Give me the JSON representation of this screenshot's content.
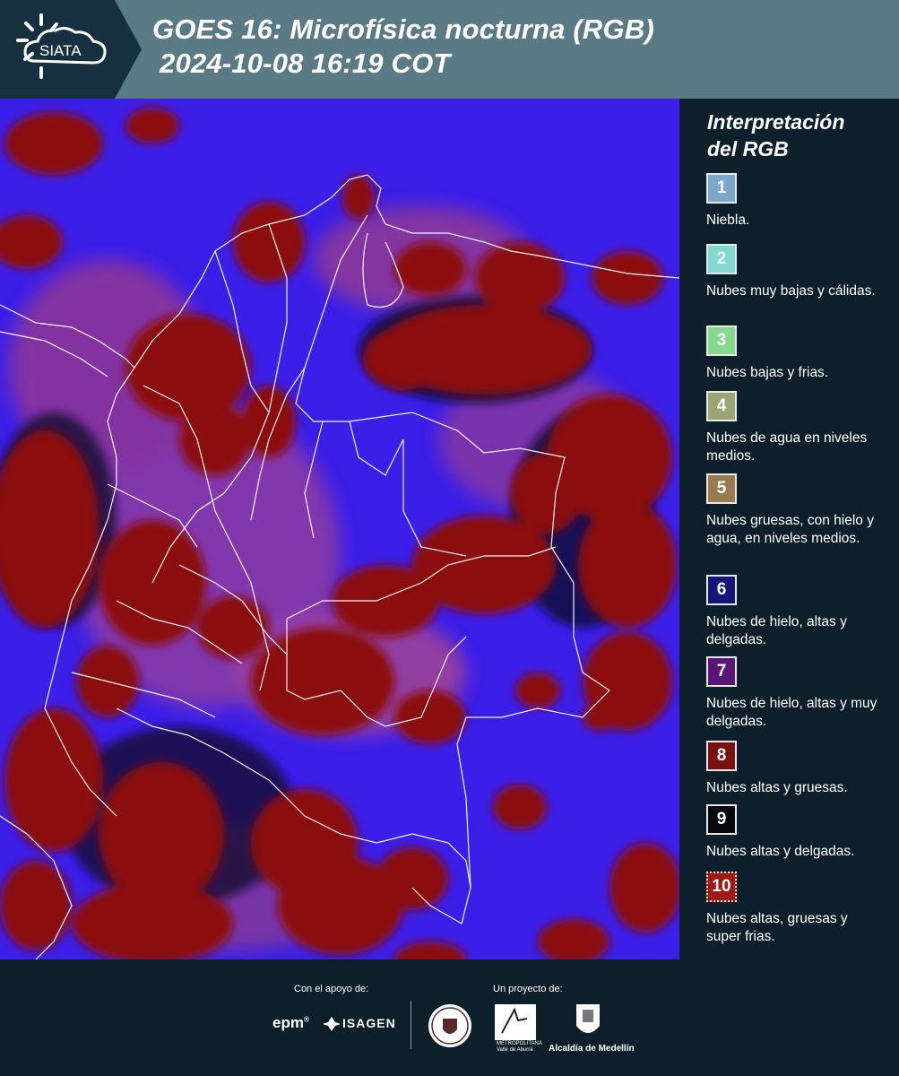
{
  "header": {
    "logo_text": "SIATA",
    "title_line1": "GOES 16: Microfísica nocturna (RGB)",
    "title_line2": "2024-10-08 16:19 COT"
  },
  "map": {
    "icon": "satellite-rgb-map",
    "colors": {
      "background": "#3b1ee8",
      "thick_clouds": "#8b1010",
      "borders": "#ffffff"
    }
  },
  "legend": {
    "title_line1": "Interpretación",
    "title_line2": "del RGB",
    "items": [
      {
        "number": "1",
        "label": "Niebla.",
        "color": "#7ba7cb"
      },
      {
        "number": "2",
        "label": "Nubes muy bajas y cálidas.",
        "color": "#7fd9d0"
      },
      {
        "number": "3",
        "label": "Nubes bajas y frias.",
        "color": "#86d98c"
      },
      {
        "number": "4",
        "label": "Nubes de agua en niveles medios.",
        "color": "#9aa571"
      },
      {
        "number": "5",
        "label": "Nubes gruesas, con hielo y agua, en niveles medios.",
        "color": "#9a7b4f"
      },
      {
        "number": "6",
        "label": "Nubes de hielo, altas y delgadas.",
        "color": "#14157a"
      },
      {
        "number": "7",
        "label": "Nubes de hielo, altas y muy delgadas.",
        "color": "#5a1578"
      },
      {
        "number": "8",
        "label": "Nubes altas y gruesas.",
        "color": "#7a1111"
      },
      {
        "number": "9",
        "label": "Nubes altas y delgadas.",
        "color": "#08080c"
      },
      {
        "number": "10",
        "label": "Nubes altas, gruesas y super frias.",
        "color": "#9e1a12"
      }
    ]
  },
  "footer": {
    "support_label": "Con el apoyo de:",
    "project_label": "Un proyecto de:",
    "sponsor1": "epm",
    "sponsor2": "ISAGEN",
    "partner_area_line1": "METROPOLITANA",
    "partner_area_line2": "Valle de Aburrá",
    "partner_alcaldia": "Alcaldía de Medellín"
  }
}
